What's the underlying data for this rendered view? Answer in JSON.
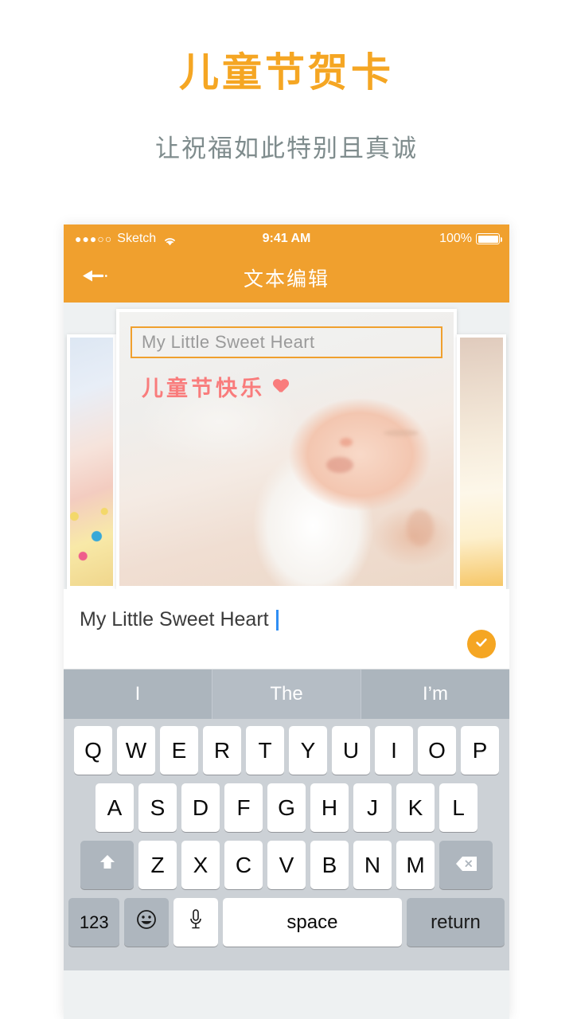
{
  "promo": {
    "title": "儿童节贺卡",
    "subtitle": "让祝福如此特别且真诚",
    "title_color": "#F5A623",
    "subtitle_color": "#7F8C8D"
  },
  "statusbar": {
    "signal_dots": "●●●○○",
    "carrier": "Sketch",
    "wifi_icon": "wifi-icon",
    "time": "9:41 AM",
    "battery_percent": "100%",
    "battery_icon": "battery-full-icon",
    "background": "#F0A02E"
  },
  "navbar": {
    "back_icon": "back-arrow-icon",
    "title": "文本编辑",
    "background": "#F0A02E",
    "title_color": "#FFFFFF"
  },
  "carousel": {
    "cards": [
      {
        "position": "left",
        "preview": true
      },
      {
        "position": "center",
        "preview": false
      },
      {
        "position": "right",
        "preview": true
      }
    ],
    "active_card": {
      "caption_value": "My Little Sweet Heart",
      "caption_color": "#9A9A9A",
      "caption_border_color": "#F0A02E",
      "greeting": "儿童节快乐",
      "greeting_color": "#F97C7C",
      "heart_icon": "heart-icon"
    }
  },
  "input_panel": {
    "value": "My Little Sweet Heart",
    "caret_color": "#2F8EF4",
    "confirm_icon": "checkmark-icon",
    "confirm_color": "#F5A623"
  },
  "predictive": {
    "suggestions": [
      "I",
      "The",
      "I’m"
    ],
    "background": "#ACB5BD"
  },
  "keyboard": {
    "row1": [
      "Q",
      "W",
      "E",
      "R",
      "T",
      "Y",
      "U",
      "I",
      "O",
      "P"
    ],
    "row2": [
      "A",
      "S",
      "D",
      "F",
      "G",
      "H",
      "J",
      "K",
      "L"
    ],
    "row3_letters": [
      "Z",
      "X",
      "C",
      "V",
      "B",
      "N",
      "M"
    ],
    "shift_icon": "shift-arrow-icon",
    "backspace_icon": "backspace-icon",
    "numbers_label": "123",
    "emoji_icon": "emoji-smiley-icon",
    "mic_icon": "microphone-icon",
    "space_label": "space",
    "return_label": "return",
    "background": "#CCD1D6"
  }
}
